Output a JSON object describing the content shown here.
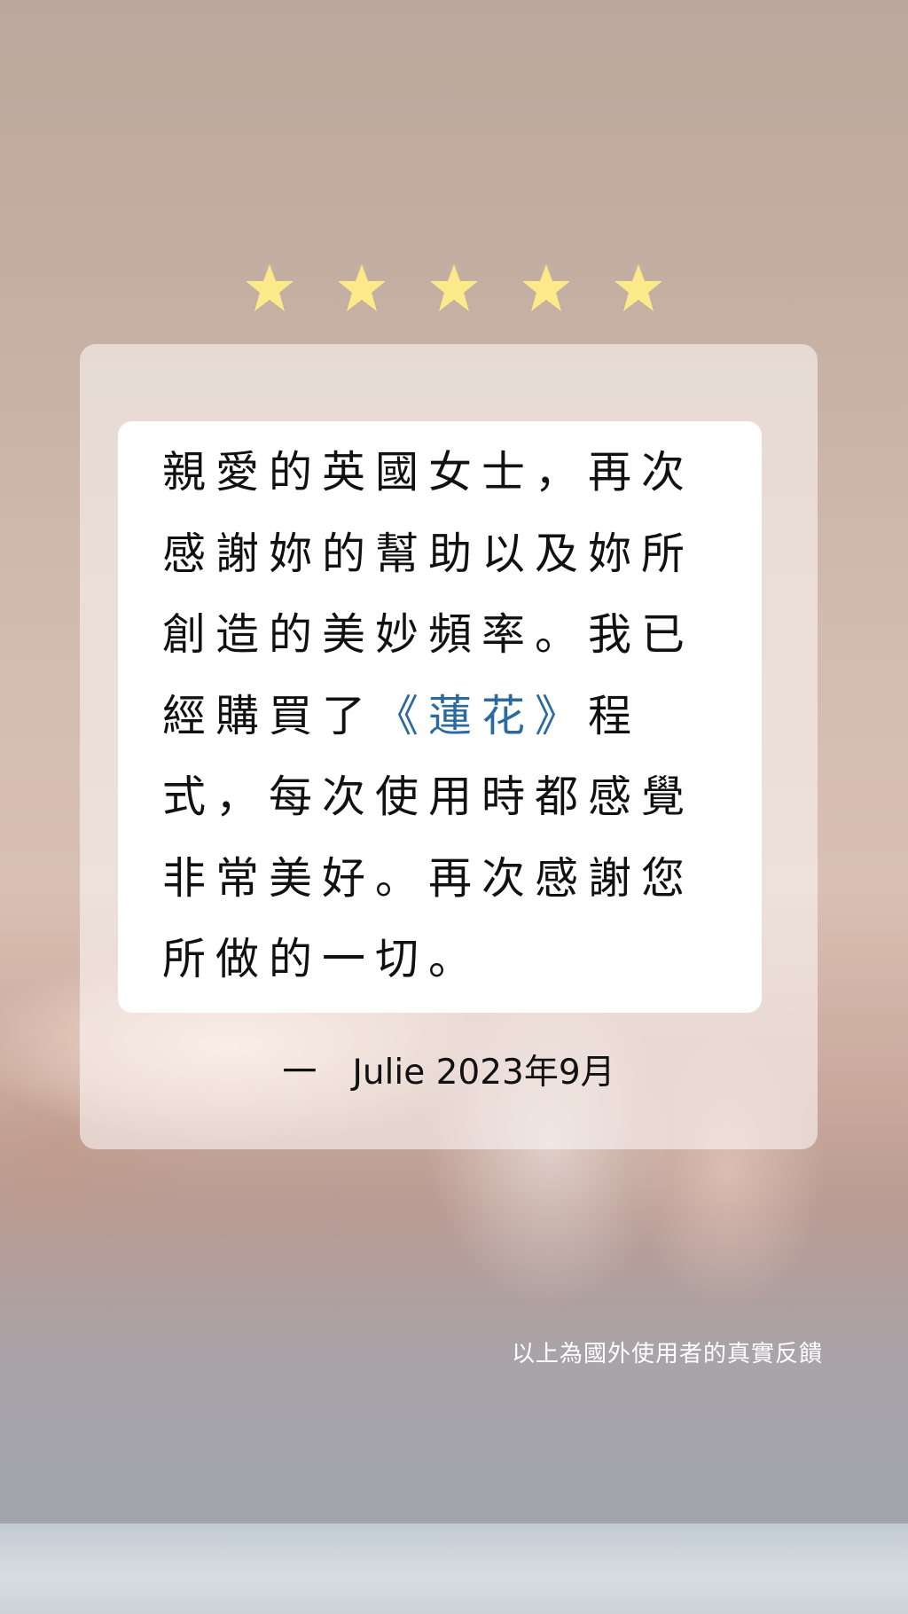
{
  "rating": {
    "stars": 5,
    "max": 5,
    "star_color": "#fce98a"
  },
  "quote": {
    "before": "親愛的英國女士，再次感謝妳的幫助以及妳所創造的美妙頻率。我已經購買了",
    "highlight": "《蓮花》",
    "after": "程式，每次使用時都感覺非常美好。再次感謝您所做的一切。",
    "highlight_color": "#2b6a9e"
  },
  "signature": {
    "dash": "一",
    "text": "Julie 2023年9月"
  },
  "footnote": "以上為國外使用者的真實反饋"
}
